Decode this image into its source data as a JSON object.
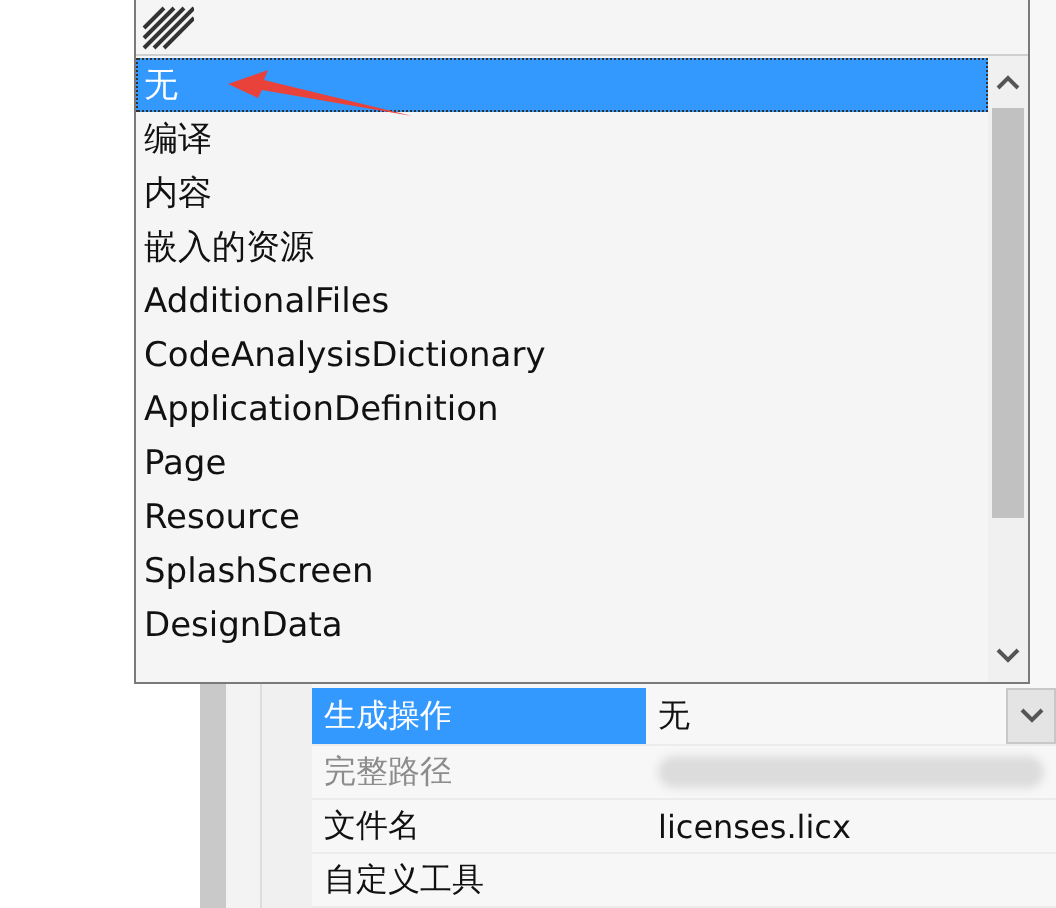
{
  "dropdown": {
    "options": [
      {
        "label": "无",
        "selected": true
      },
      {
        "label": "编译",
        "selected": false
      },
      {
        "label": "内容",
        "selected": false
      },
      {
        "label": "嵌入的资源",
        "selected": false
      },
      {
        "label": "AdditionalFiles",
        "selected": false
      },
      {
        "label": "CodeAnalysisDictionary",
        "selected": false
      },
      {
        "label": "ApplicationDefinition",
        "selected": false
      },
      {
        "label": "Page",
        "selected": false
      },
      {
        "label": "Resource",
        "selected": false
      },
      {
        "label": "SplashScreen",
        "selected": false
      },
      {
        "label": "DesignData",
        "selected": false
      }
    ]
  },
  "properties": [
    {
      "name": "生成操作",
      "value": "无",
      "selected": true,
      "disabled": false,
      "kind": "dropdown"
    },
    {
      "name": "完整路径",
      "selected": false,
      "disabled": true,
      "kind": "redacted"
    },
    {
      "name": "文件名",
      "value": "licenses.licx",
      "selected": false,
      "disabled": false,
      "kind": "text"
    },
    {
      "name": "自定义工具",
      "selected": false,
      "disabled": false,
      "kind": "text"
    }
  ]
}
